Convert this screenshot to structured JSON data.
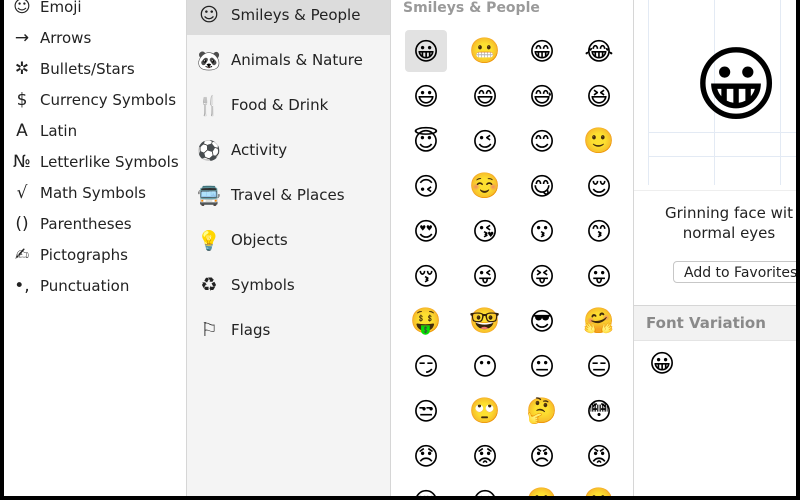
{
  "categories": [
    {
      "icon": "☺",
      "icon_name": "emoji-face-icon",
      "label": "Emoji"
    },
    {
      "icon": "→",
      "icon_name": "arrow-right-icon",
      "label": "Arrows"
    },
    {
      "icon": "✲",
      "icon_name": "asterisk-star-icon",
      "label": "Bullets/Stars"
    },
    {
      "icon": "$",
      "icon_name": "dollar-sign-icon",
      "label": "Currency Symbols"
    },
    {
      "icon": "A",
      "icon_name": "letter-a-icon",
      "label": "Latin"
    },
    {
      "icon": "№",
      "icon_name": "numero-sign-icon",
      "label": "Letterlike Symbols"
    },
    {
      "icon": "√",
      "icon_name": "square-root-icon",
      "label": "Math Symbols"
    },
    {
      "icon": "()",
      "icon_name": "parentheses-icon",
      "label": "Parentheses"
    },
    {
      "icon": "✍",
      "icon_name": "writing-hand-icon",
      "label": "Pictographs"
    },
    {
      "icon": "•,",
      "icon_name": "punctuation-icon",
      "label": "Punctuation"
    }
  ],
  "subcategories": [
    {
      "icon": "☺",
      "icon_name": "smiley-face-icon",
      "label": "Smileys & People",
      "active": true
    },
    {
      "icon": "🐼",
      "icon_name": "panda-icon",
      "label": "Animals & Nature"
    },
    {
      "icon": "🍴",
      "icon_name": "food-icon",
      "label": "Food & Drink"
    },
    {
      "icon": "⚽",
      "icon_name": "soccer-ball-icon",
      "label": "Activity"
    },
    {
      "icon": "🚍",
      "icon_name": "bus-icon",
      "label": "Travel & Places"
    },
    {
      "icon": "💡",
      "icon_name": "light-bulb-icon",
      "label": "Objects"
    },
    {
      "icon": "♻",
      "icon_name": "symbols-icon",
      "label": "Symbols"
    },
    {
      "icon": "⚐",
      "icon_name": "flag-icon",
      "label": "Flags"
    }
  ],
  "grid": {
    "heading": "Smileys & People",
    "emojis": [
      "😀",
      "😬",
      "😁",
      "😂",
      "😃",
      "😄",
      "😅",
      "😆",
      "😇",
      "😉",
      "😊",
      "🙂",
      "🙃",
      "☺️",
      "😋",
      "😌",
      "😍",
      "😘",
      "😗",
      "😙",
      "😚",
      "😜",
      "😝",
      "😛",
      "🤑",
      "🤓",
      "😎",
      "🤗",
      "😏",
      "😶",
      "😐",
      "😑",
      "😒",
      "🙄",
      "🤔",
      "😳",
      "😞",
      "😟",
      "😠",
      "😡",
      "😔",
      "😕",
      "🙁",
      "☹️"
    ],
    "selected_index": 0
  },
  "preview": {
    "emoji": "😀",
    "name_line1": "Grinning face wit",
    "name_line2": "normal eyes",
    "add_favorites": "Add to Favorites"
  },
  "font_variation": {
    "label": "Font Variation",
    "emoji": "😀"
  }
}
